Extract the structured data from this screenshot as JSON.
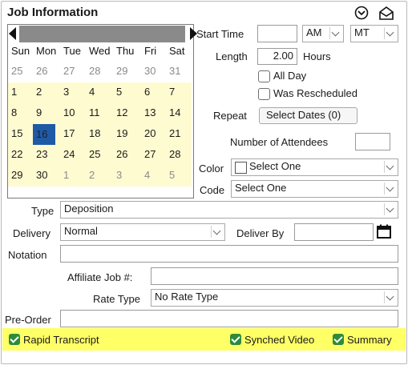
{
  "header": {
    "title": "Job Information"
  },
  "calendar": {
    "days_of_week": [
      "Sun",
      "Mon",
      "Tue",
      "Wed",
      "Thu",
      "Fri",
      "Sat"
    ],
    "weeks": [
      [
        "25",
        "26",
        "27",
        "28",
        "29",
        "30",
        "31"
      ],
      [
        "1",
        "2",
        "3",
        "4",
        "5",
        "6",
        "7"
      ],
      [
        "8",
        "9",
        "10",
        "11",
        "12",
        "13",
        "14"
      ],
      [
        "15",
        "16",
        "17",
        "18",
        "19",
        "20",
        "21"
      ],
      [
        "22",
        "23",
        "24",
        "25",
        "26",
        "27",
        "28"
      ],
      [
        "29",
        "30",
        "1",
        "2",
        "3",
        "4",
        "5"
      ]
    ],
    "selected_day": "16"
  },
  "start_time": {
    "label": "Start Time",
    "value": "",
    "ampm": "AM",
    "timezone": "MT"
  },
  "length": {
    "label": "Length",
    "value": "2.00",
    "unit": "Hours"
  },
  "all_day": {
    "label": "All Day",
    "checked": false
  },
  "rescheduled": {
    "label": "Was Rescheduled",
    "checked": false
  },
  "repeat": {
    "label": "Repeat",
    "button": "Select Dates (0)"
  },
  "attendees": {
    "label": "Number of Attendees",
    "value": ""
  },
  "color": {
    "label": "Color",
    "value": "Select One"
  },
  "code": {
    "label": "Code",
    "value": "Select One"
  },
  "type": {
    "label": "Type",
    "value": "Deposition"
  },
  "delivery": {
    "label": "Delivery",
    "value": "Normal"
  },
  "deliver_by": {
    "label": "Deliver By",
    "value": ""
  },
  "notation": {
    "label": "Notation",
    "value": ""
  },
  "affiliate_job": {
    "label": "Affiliate Job #:",
    "value": ""
  },
  "rate_type": {
    "label": "Rate Type",
    "value": "No Rate Type"
  },
  "pre_order": {
    "label": "Pre-Order",
    "value": ""
  },
  "options": {
    "rapid_transcript": {
      "label": "Rapid Transcript",
      "checked": true
    },
    "synched_video": {
      "label": "Synched Video",
      "checked": true
    },
    "summary": {
      "label": "Summary",
      "checked": true
    }
  },
  "colors": {
    "highlight": "#ffff66",
    "selected_day": "#1f5aa6",
    "current_weeks": "#fffbd0",
    "checkbox_green": "#2e8b3a"
  }
}
